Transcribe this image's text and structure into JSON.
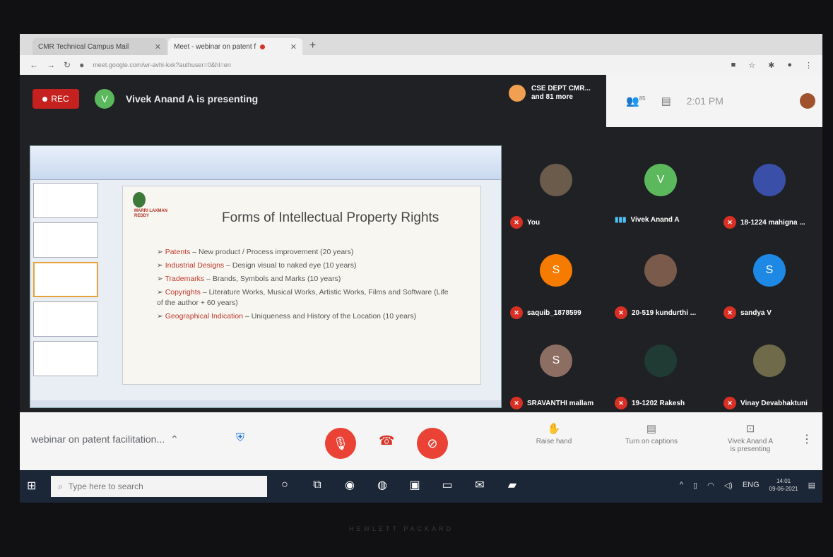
{
  "browser": {
    "tabs": [
      {
        "title": "CMR Technical Campus Mail",
        "active": false
      },
      {
        "title": "Meet - webinar on patent f",
        "active": true,
        "recording": true
      }
    ],
    "new_tab": "+",
    "url": "meet.google.com/wr-avhi-kxk?authuser=0&hl=en"
  },
  "meet": {
    "rec_label": "REC",
    "presenter_initial": "V",
    "presenting_text": "Vivek Anand A is presenting",
    "org_line1": "CSE DEPT CMR...",
    "org_line2": "and 81 more",
    "participants_count": "85",
    "time": "2:01 PM",
    "meeting_name": "webinar on patent facilitation...",
    "controls": {
      "raise_hand": "Raise hand",
      "captions": "Turn on captions",
      "presenting_line1": "Vivek Anand A",
      "presenting_line2": "is presenting"
    }
  },
  "slide": {
    "logo_text": "MARRI LAXMAN REDDY",
    "title": "Forms of Intellectual Property Rights",
    "items": [
      {
        "label": "Patents",
        "text": " – New product / Process improvement (20 years)"
      },
      {
        "label": "Industrial Designs",
        "text": " – Design visual to naked eye (10 years)"
      },
      {
        "label": "Trademarks",
        "text": " – Brands, Symbols and Marks (10 years)"
      },
      {
        "label": "Copyrights",
        "text": " – Literature Works, Musical Works, Artistic Works, Films and Software (Life of the author + 60 years)"
      },
      {
        "label": "Geographical Indication",
        "text": " – Uniqueness and History of the Location (10 years)"
      }
    ]
  },
  "participants": [
    {
      "name": "You",
      "initial": "",
      "color": "#6b5b4b",
      "muted": true
    },
    {
      "name": "Vivek Anand A",
      "initial": "V",
      "color": "#5cb85c",
      "muted": false
    },
    {
      "name": "18-1224 mahigna ...",
      "initial": "",
      "color": "#3a4fa8",
      "muted": true
    },
    {
      "name": "saquib_1878599",
      "initial": "S",
      "color": "#f57c00",
      "muted": true
    },
    {
      "name": "20-519 kundurthi ...",
      "initial": "",
      "color": "#7a5a4a",
      "muted": true
    },
    {
      "name": "sandya V",
      "initial": "S",
      "color": "#1e88e5",
      "muted": true
    },
    {
      "name": "SRAVANTHI mallam",
      "initial": "S",
      "color": "#8d6e63",
      "muted": true
    },
    {
      "name": "19-1202 Rakesh",
      "initial": "",
      "color": "#1f3b33",
      "muted": true
    },
    {
      "name": "Vinay Devabhaktuni",
      "initial": "",
      "color": "#6e6a4a",
      "muted": true
    }
  ],
  "taskbar": {
    "search_placeholder": "Type here to search",
    "lang": "ENG",
    "clock_time": "14:01",
    "clock_date": "09-06-2021"
  },
  "laptop_brand": "HEWLETT PACKARD",
  "colors": {
    "rec": "#c5221f",
    "mute": "#d93025",
    "end_call": "#ea4335",
    "taskbar": "#1b2636"
  }
}
